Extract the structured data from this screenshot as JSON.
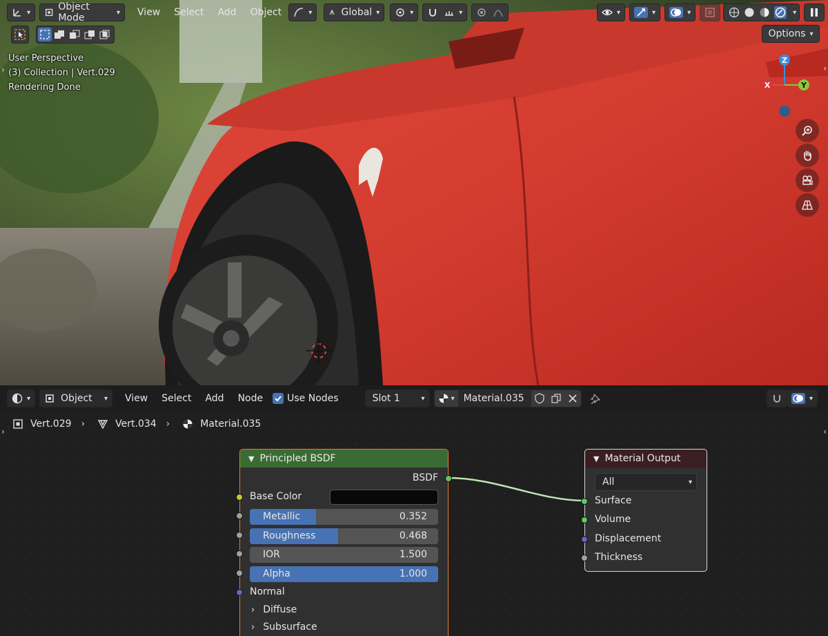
{
  "viewport_header": {
    "mode": "Object Mode",
    "menus": [
      "View",
      "Select",
      "Add",
      "Object"
    ],
    "transform_orientation": "Global",
    "options_label": "Options"
  },
  "viewport_info": {
    "line1": "User Perspective",
    "line2": "(3) Collection | Vert.029",
    "line3": "Rendering Done"
  },
  "gizmo": {
    "x": "X",
    "y": "Y",
    "z": "Z"
  },
  "node_editor_header": {
    "object_type": "Object",
    "menus": [
      "View",
      "Select",
      "Add",
      "Node"
    ],
    "use_nodes_label": "Use Nodes",
    "use_nodes_checked": true,
    "slot": "Slot 1",
    "material": "Material.035"
  },
  "breadcrumb": {
    "object": "Vert.029",
    "mesh": "Vert.034",
    "material": "Material.035"
  },
  "principled_node": {
    "title": "Principled BSDF",
    "output": "BSDF",
    "base_color_label": "Base Color",
    "base_color_value": "#080808",
    "sliders": [
      {
        "name": "Metallic",
        "value": "0.352",
        "fraction": 0.352,
        "highlight": true
      },
      {
        "name": "Roughness",
        "value": "0.468",
        "fraction": 0.468,
        "highlight": true
      },
      {
        "name": "IOR",
        "value": "1.500",
        "fraction": 0.0,
        "highlight": false
      },
      {
        "name": "Alpha",
        "value": "1.000",
        "fraction": 1.0,
        "highlight": true
      }
    ],
    "normal_label": "Normal",
    "panels": [
      "Diffuse",
      "Subsurface"
    ]
  },
  "output_node": {
    "title": "Material Output",
    "target": "All",
    "inputs": [
      "Surface",
      "Volume",
      "Displacement",
      "Thickness"
    ]
  },
  "colors": {
    "accent": "#4772b3",
    "shader_header": "#3a6b32",
    "output_header": "#3a1e22",
    "socket_shader": "#63c763",
    "socket_color": "#c7c729",
    "socket_float": "#a1a1a1",
    "socket_vector": "#6363c7"
  }
}
